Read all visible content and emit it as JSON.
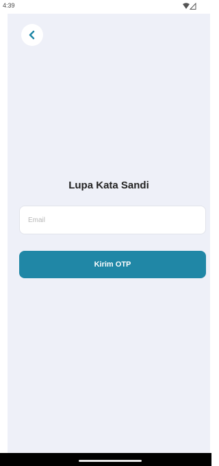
{
  "status_bar": {
    "time": "4:39",
    "wifi_icon": "wifi-icon",
    "signal_icon": "signal-icon"
  },
  "header": {
    "back_icon": "chevron-left-icon"
  },
  "form": {
    "title": "Lupa Kata Sandi",
    "email_placeholder": "Email",
    "email_value": "",
    "submit_label": "Kirim OTP"
  },
  "colors": {
    "accent": "#2087a6",
    "background": "#eef0f8",
    "nav_bar": "#000000"
  }
}
